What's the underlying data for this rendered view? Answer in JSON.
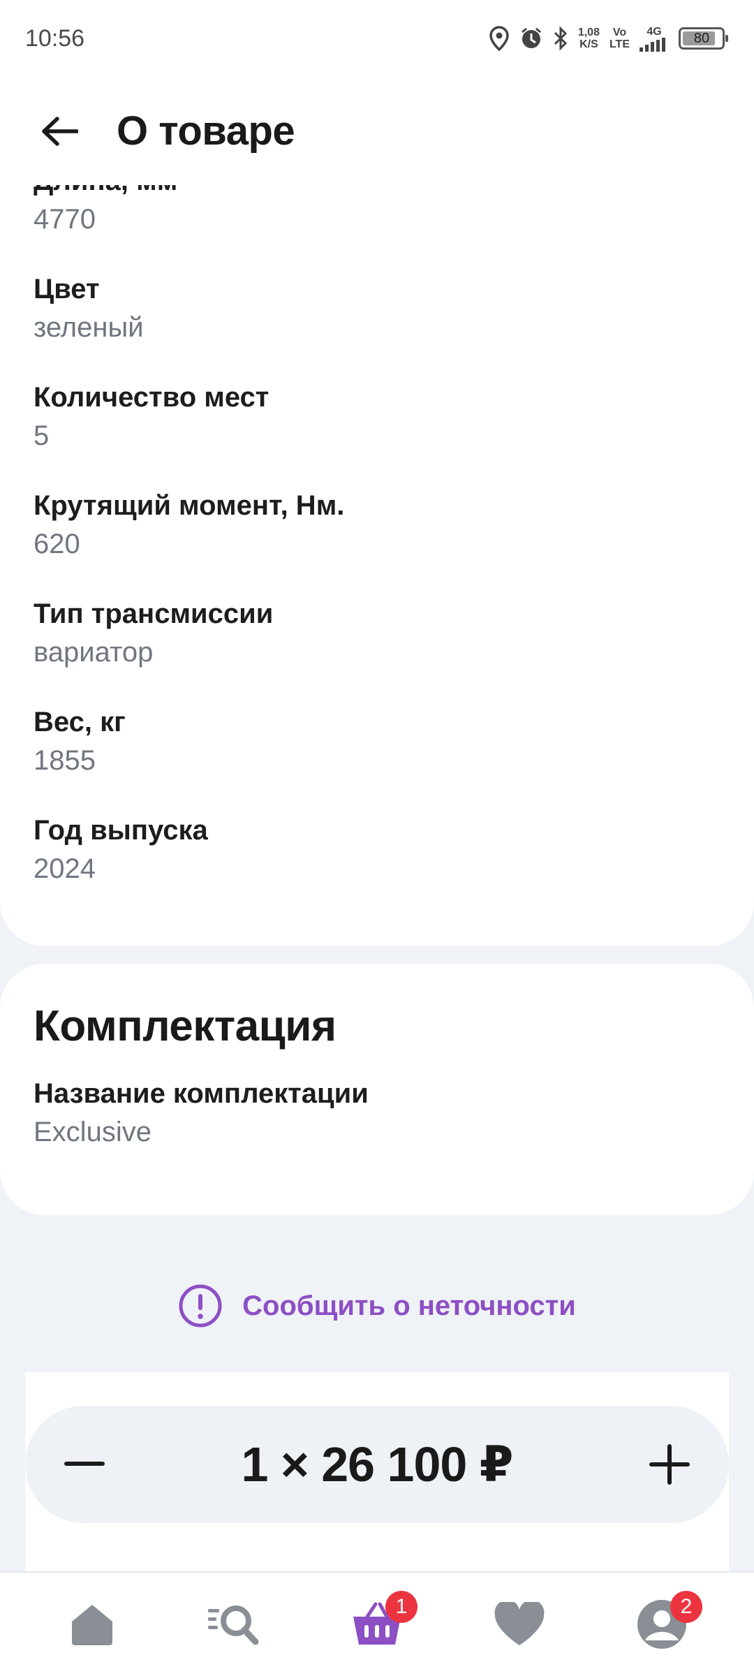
{
  "status_bar": {
    "time": "10:56",
    "speed_top": "1,08",
    "speed_bottom": "K/S",
    "volte_top": "Vo",
    "volte_bottom": "LTE",
    "network": "4G",
    "battery": "80"
  },
  "header": {
    "title": "О товаре"
  },
  "specs": [
    {
      "label": "Длина, мм",
      "value": "4770"
    },
    {
      "label": "Цвет",
      "value": "зеленый"
    },
    {
      "label": "Количество мест",
      "value": "5"
    },
    {
      "label": "Крутящий момент, Нм.",
      "value": "620"
    },
    {
      "label": "Тип трансмиссии",
      "value": "вариатор"
    },
    {
      "label": "Вес, кг",
      "value": "1855"
    },
    {
      "label": "Год выпуска",
      "value": "2024"
    }
  ],
  "equipment": {
    "title": "Комплектация",
    "label": "Название комплектации",
    "value": "Exclusive"
  },
  "report_link": "Сообщить о неточности",
  "purchase": {
    "quantity_price": "1 × 26 100 ₽"
  },
  "nav": {
    "cart_badge": "1",
    "profile_badge": "2"
  },
  "colors": {
    "accent": "#8c4fc4",
    "badge": "#ec3440",
    "icon_gray": "#8a8f96"
  }
}
